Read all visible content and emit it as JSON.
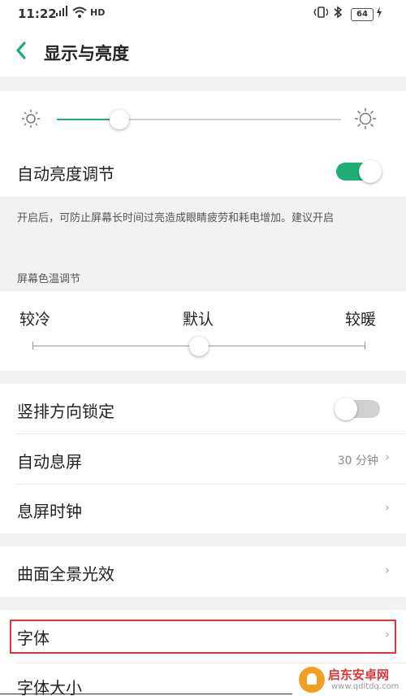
{
  "status_bar": {
    "time": "11:22",
    "battery": "64",
    "icons": [
      "signal-icon",
      "wifi-icon",
      "hd-icon",
      "vibrate-icon",
      "bluetooth-icon",
      "battery-icon",
      "charging-icon"
    ]
  },
  "header": {
    "title": "显示与亮度",
    "back_icon": "chevron-left-icon"
  },
  "brightness": {
    "level": 0.22,
    "min_icon": "sun-small-icon",
    "max_icon": "sun-large-icon"
  },
  "auto_brightness": {
    "label": "自动亮度调节",
    "on": true
  },
  "note": "开启后，可防止屏幕长时间过亮造成眼睛疲劳和耗电增加。建议开启",
  "color_temp": {
    "section_title": "屏幕色温调节",
    "labels": [
      "较冷",
      "默认",
      "较暖"
    ],
    "level": 0.5
  },
  "rotation_lock": {
    "label": "竖排方向锁定",
    "on": false
  },
  "screen_timeout": {
    "label": "自动息屏",
    "value": "30 分钟"
  },
  "aod_clock": {
    "label": "息屏时钟"
  },
  "edge_light": {
    "label": "曲面全景光效"
  },
  "font": {
    "label": "字体"
  },
  "font_size": {
    "label": "字体大小"
  },
  "chevron": "›",
  "watermark": {
    "name": "启东安卓网",
    "url": "www.qdltdq.com"
  },
  "colors": {
    "accent": "#1fae74",
    "toggle_off": "#d0d0d0",
    "highlight": "#e0353a",
    "gap": "#f2f2f2"
  }
}
